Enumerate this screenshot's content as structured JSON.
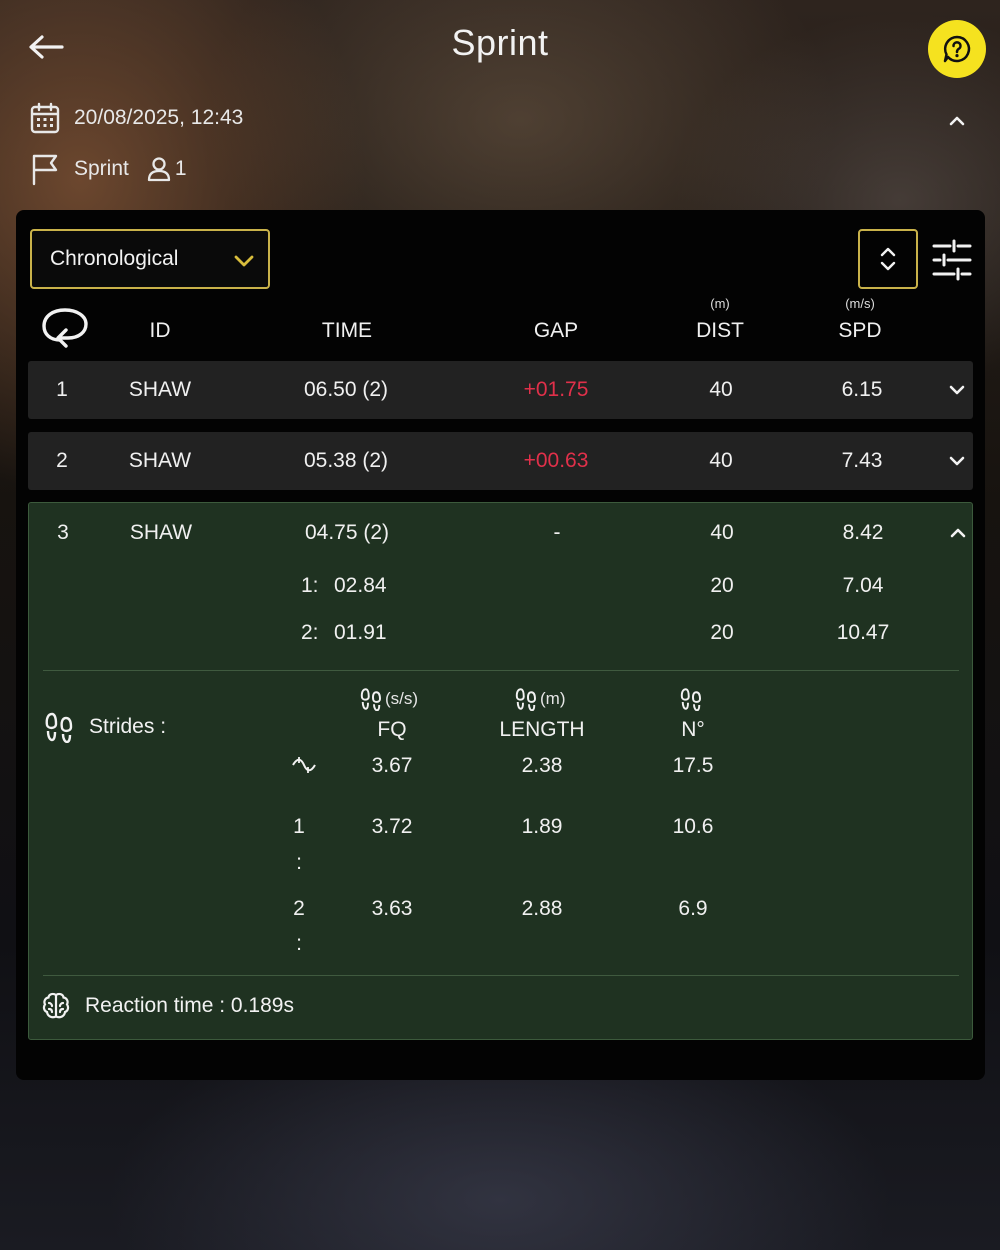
{
  "header": {
    "back_icon": "arrow-left-icon",
    "title": "Sprint",
    "help_icon": "chat-question-icon",
    "help_color": "#f5e21f"
  },
  "session": {
    "date_icon": "calendar-icon",
    "datetime": "20/08/2025, 12:43",
    "event_icon": "flag-icon",
    "event_type": "Sprint",
    "athlete_icon": "person-icon",
    "athletes": "1",
    "collapse_icon": "chevron-up-icon"
  },
  "controls": {
    "sort_value": "Chronological",
    "order_icon": "sort-updown-icon",
    "filter_icon": "sliders-icon",
    "accent_color": "#c9b24a"
  },
  "table": {
    "headers": {
      "lap_icon": "lap-loop-icon",
      "id": "ID",
      "time": "TIME",
      "gap": "GAP",
      "dist": "DIST",
      "dist_unit": "(m)",
      "spd": "SPD",
      "spd_unit": "(m/s)"
    },
    "rows": [
      {
        "num": "1",
        "id": "SHAW",
        "time": "06.50 (2)",
        "gap": "+01.75",
        "dist": "40",
        "spd": "6.15"
      },
      {
        "num": "2",
        "id": "SHAW",
        "time": "05.38 (2)",
        "gap": "+00.63",
        "dist": "40",
        "spd": "7.43"
      },
      {
        "num": "3",
        "id": "SHAW",
        "time": "04.75 (2)",
        "gap": "-",
        "dist": "40",
        "spd": "8.42"
      }
    ],
    "gap_color": "#e0304a",
    "splits": [
      {
        "label": "1:",
        "time": "02.84",
        "dist": "20",
        "spd": "7.04"
      },
      {
        "label": "2:",
        "time": "01.91",
        "dist": "20",
        "spd": "10.47"
      }
    ],
    "strides": {
      "label": "Strides :",
      "icon": "footprints-icon",
      "avg_icon": "average-tilde-icon",
      "headers": {
        "fq": "FQ",
        "fq_unit": "(s/s)",
        "length": "LENGTH",
        "length_unit": "(m)",
        "n": "N°"
      },
      "average": {
        "fq": "3.67",
        "length": "2.38",
        "n": "17.5"
      },
      "splits": [
        {
          "label_num": "1",
          "label_colon": ":",
          "fq": "3.72",
          "length": "1.89",
          "n": "10.6"
        },
        {
          "label_num": "2",
          "label_colon": ":",
          "fq": "3.63",
          "length": "2.88",
          "n": "6.9"
        }
      ]
    },
    "reaction": {
      "icon": "brain-icon",
      "text": "Reaction time : 0.189s"
    },
    "expanded_bg": "#1f3221"
  }
}
